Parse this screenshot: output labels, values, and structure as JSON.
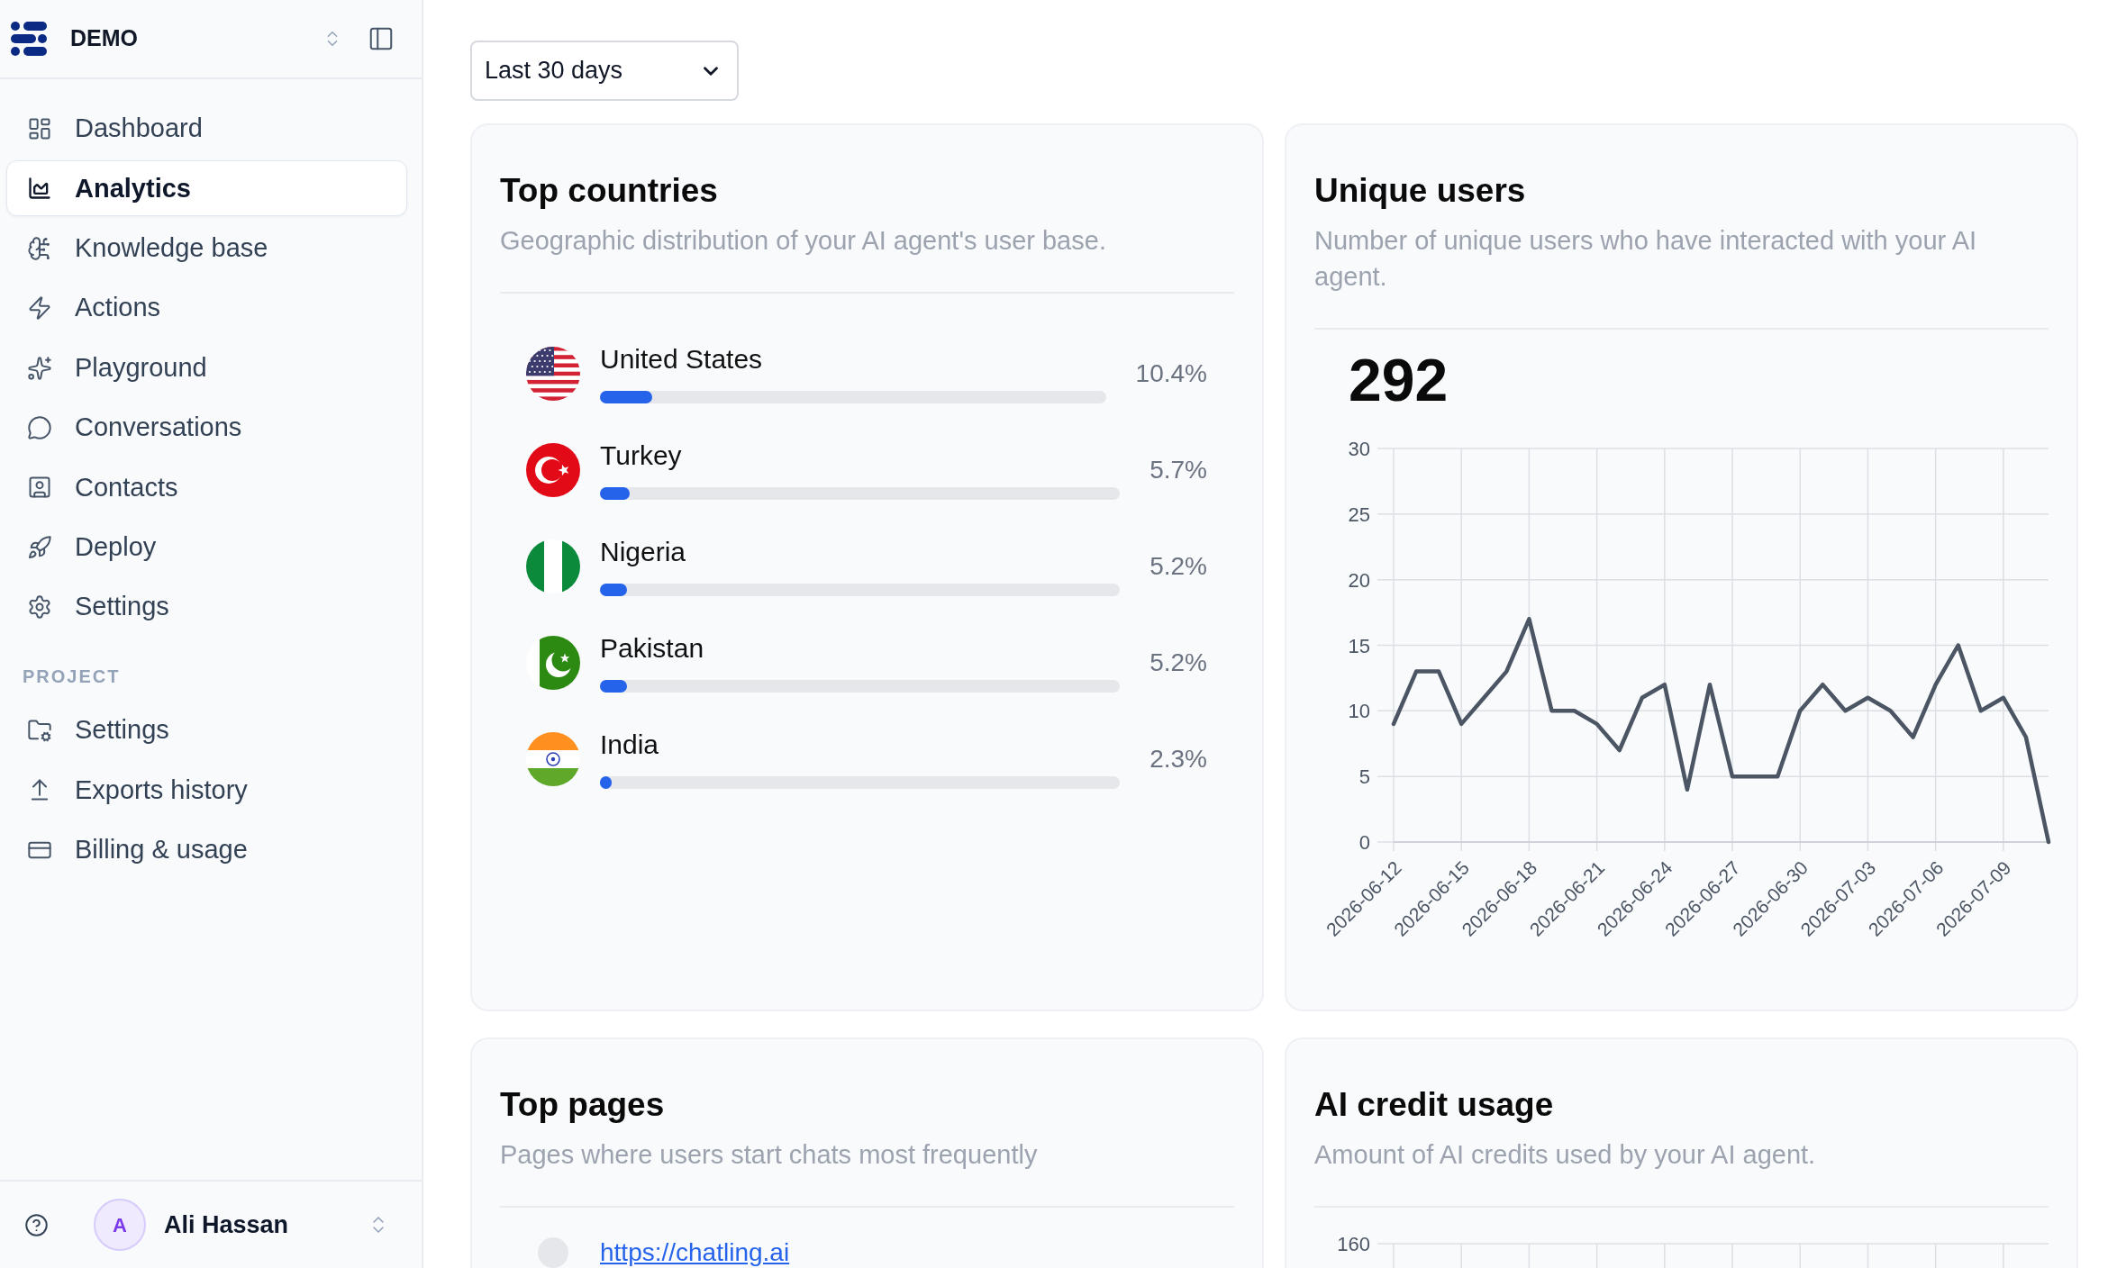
{
  "sidebar": {
    "workspace": "DEMO",
    "nav": [
      {
        "label": "Dashboard",
        "selected": false
      },
      {
        "label": "Analytics",
        "selected": true
      },
      {
        "label": "Knowledge base",
        "selected": false
      },
      {
        "label": "Actions",
        "selected": false
      },
      {
        "label": "Playground",
        "selected": false
      },
      {
        "label": "Conversations",
        "selected": false
      },
      {
        "label": "Contacts",
        "selected": false
      },
      {
        "label": "Deploy",
        "selected": false
      },
      {
        "label": "Settings",
        "selected": false
      }
    ],
    "project_section": {
      "label": "PROJECT",
      "items": [
        {
          "label": "Settings",
          "selected": false
        },
        {
          "label": "Exports history",
          "selected": false
        },
        {
          "label": "Billing & usage",
          "selected": false
        }
      ]
    },
    "user": {
      "initial": "A",
      "name": "Ali Hassan"
    }
  },
  "period_select": {
    "value": "Last 30 days"
  },
  "top_countries": {
    "title": "Top countries",
    "subtitle": "Geographic distribution of your AI agent's user base.",
    "countries": [
      {
        "name": "United States",
        "kind": "us",
        "percent": "10.4%",
        "level": 0.104
      },
      {
        "name": "Turkey",
        "kind": "tr",
        "percent": "5.7%",
        "level": 0.057
      },
      {
        "name": "Nigeria",
        "kind": "ng",
        "percent": "5.2%",
        "level": 0.052
      },
      {
        "name": "Pakistan",
        "kind": "pk",
        "percent": "5.2%",
        "level": 0.052
      },
      {
        "name": "India",
        "kind": "in",
        "percent": "2.3%",
        "level": 0.023
      }
    ]
  },
  "unique_users": {
    "title": "Unique users",
    "subtitle": "Number of unique users who have interacted with your AI agent.",
    "total": "292",
    "chart_data": {
      "type": "line",
      "x": [
        "2026-06-12",
        "2026-06-13",
        "2026-06-14",
        "2026-06-15",
        "2026-06-16",
        "2026-06-17",
        "2026-06-18",
        "2026-06-19",
        "2026-06-20",
        "2026-06-21",
        "2026-06-22",
        "2026-06-23",
        "2026-06-24",
        "2026-06-25",
        "2026-06-26",
        "2026-06-27",
        "2026-06-28",
        "2026-06-29",
        "2026-06-30",
        "2026-07-01",
        "2026-07-02",
        "2026-07-03",
        "2026-07-04",
        "2026-07-05",
        "2026-07-06",
        "2026-07-07",
        "2026-07-08",
        "2026-07-09",
        "2026-07-10",
        "2026-07-11"
      ],
      "values": [
        9,
        13,
        13,
        9,
        11,
        13,
        17,
        10,
        10,
        9,
        7,
        11,
        12,
        4,
        12,
        5,
        5,
        5,
        10,
        12,
        10,
        11,
        10,
        8,
        12,
        15,
        10,
        11,
        8,
        0
      ],
      "color": "#4b5563",
      "xlim": [
        "2026-06-12",
        "2026-07-11"
      ],
      "xticks": [
        "2026-06-12",
        "2026-06-15",
        "2026-06-18",
        "2026-06-21",
        "2026-06-24",
        "2026-06-27",
        "2026-06-30",
        "2026-07-03",
        "2026-07-06",
        "2026-07-09"
      ],
      "yticks": [
        0,
        5,
        10,
        15,
        20,
        25,
        30
      ],
      "ylim": [
        0,
        30
      ],
      "grid": true
    }
  },
  "top_pages": {
    "title": "Top pages",
    "subtitle": "Pages where users start chats most frequently",
    "pages": [
      {
        "url": "https://chatling.ai"
      }
    ]
  },
  "ai_credit_usage": {
    "title": "AI credit usage",
    "subtitle": "Amount of AI credits used by your AI agent.",
    "axis_label": "160"
  }
}
